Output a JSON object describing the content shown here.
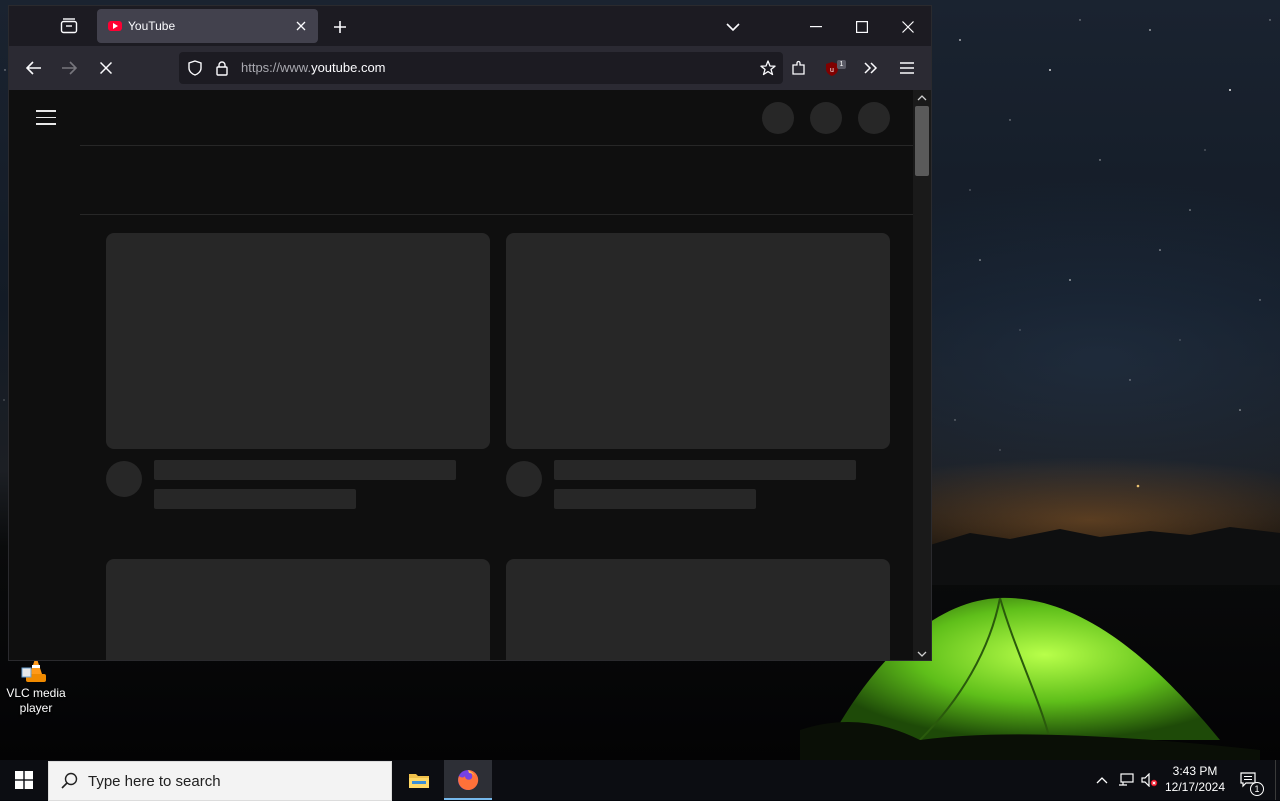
{
  "desktop": {
    "icons": [
      {
        "label": "VLC media player",
        "icon": "vlc-cone-icon"
      }
    ]
  },
  "browser": {
    "tab": {
      "title": "YouTube",
      "favicon": "youtube-icon"
    },
    "address": {
      "prefix": "https://www.",
      "domain": "youtube.com"
    },
    "extension_badge": "1",
    "loading": true,
    "accent_color": "#ff0033"
  },
  "page": {
    "state": "loading-skeleton",
    "video_cards_visible": 4
  },
  "taskbar": {
    "search_placeholder": "Type here to search",
    "pinned": [
      "file-explorer-icon",
      "firefox-icon"
    ],
    "clock_time": "3:43 PM",
    "clock_date": "12/17/2024",
    "notification_count": "1"
  }
}
